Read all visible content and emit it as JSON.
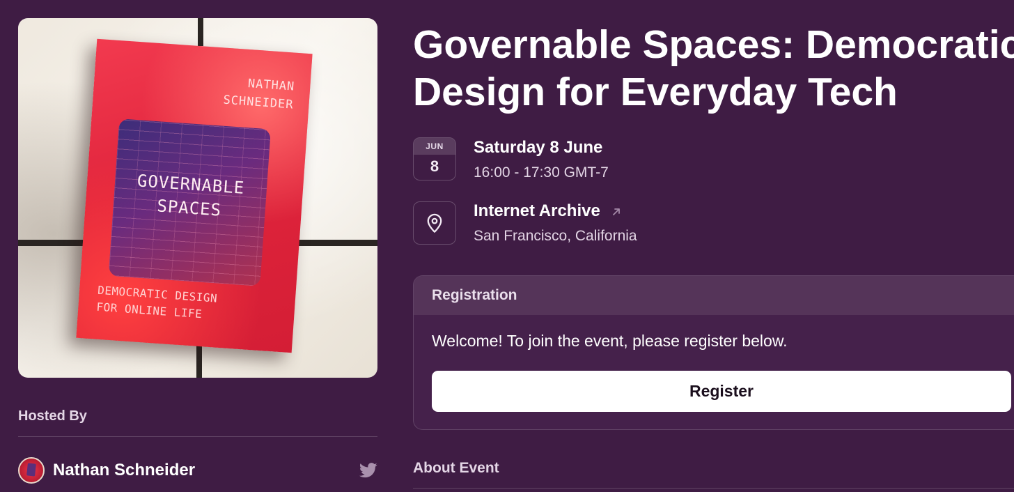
{
  "cover": {
    "author": [
      "NATHAN",
      "SCHNEIDER"
    ],
    "title": [
      "GOVERNABLE",
      "SPACES"
    ],
    "subtitle": [
      "DEMOCRATIC DESIGN",
      "FOR ONLINE LIFE"
    ]
  },
  "event": {
    "title_lines": [
      "Governable Spaces: Democratic",
      "Design for Everyday Tech"
    ]
  },
  "date": {
    "month": "JUN",
    "day": "8",
    "full": "Saturday 8 June",
    "time": "16:00 - 17:30 GMT-7"
  },
  "location": {
    "icon": "map-pin-icon",
    "venue": "Internet Archive",
    "city": "San Francisco, California"
  },
  "registration": {
    "header": "Registration",
    "welcome": "Welcome! To join the event, please register below.",
    "button": "Register"
  },
  "hosted": {
    "label": "Hosted By",
    "host_name": "Nathan Schneider",
    "social_icon": "twitter-icon"
  },
  "about": {
    "label": "About Event"
  },
  "colors": {
    "background": "#3f1c44",
    "card_header": "#553459",
    "button": "#ffffff",
    "book_red": "#e0243c"
  }
}
